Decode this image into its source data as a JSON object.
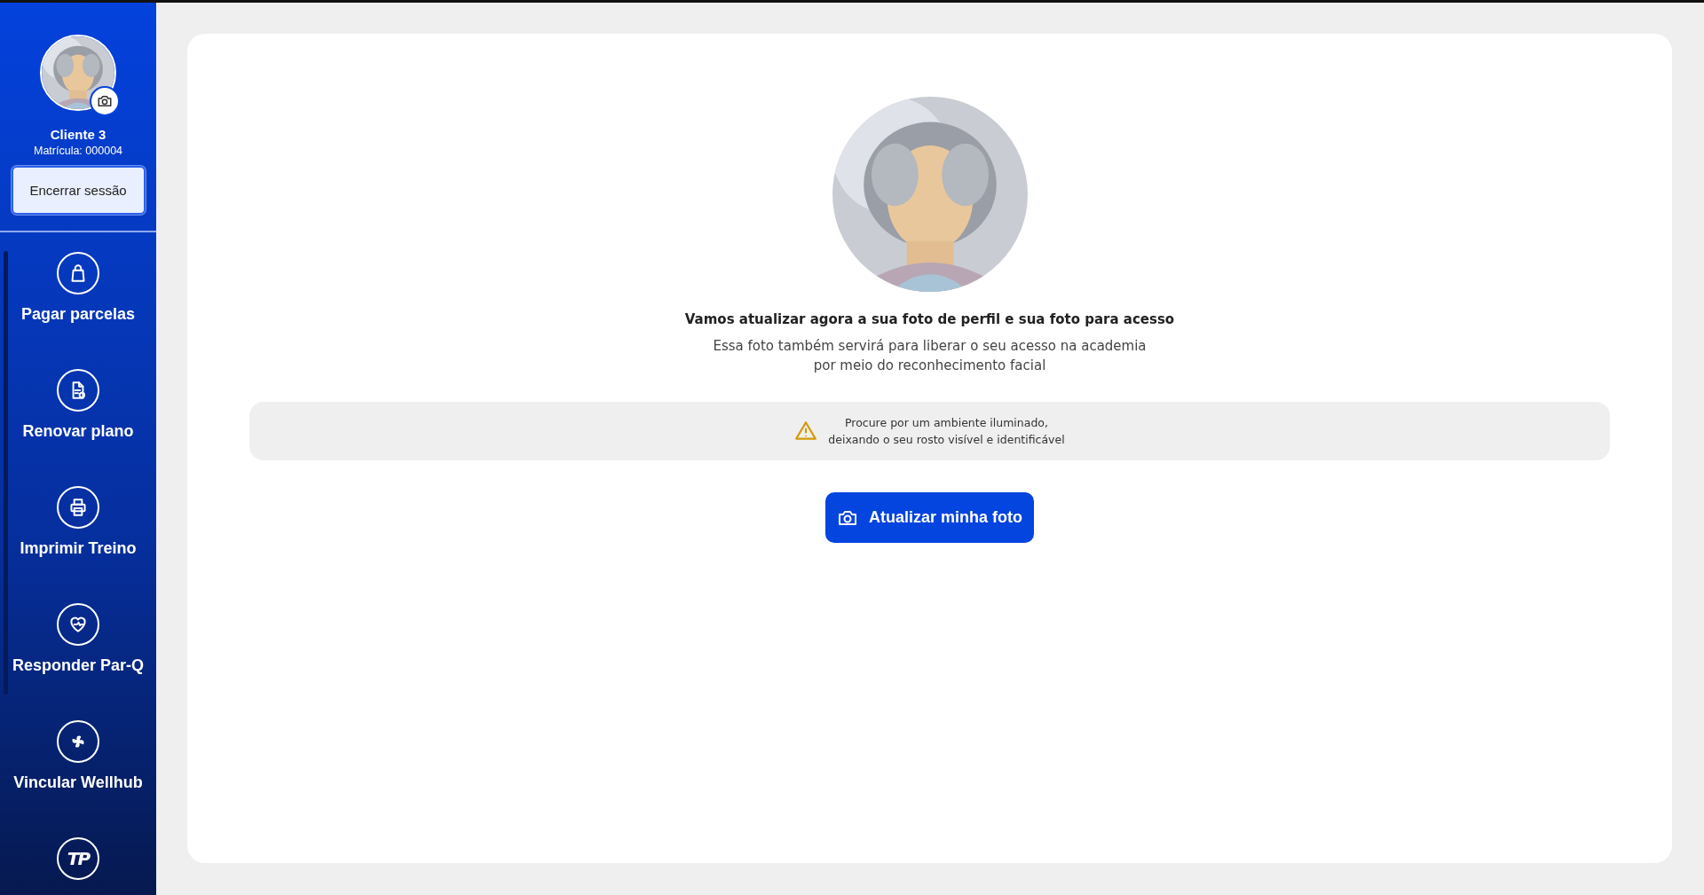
{
  "sidebar": {
    "user": {
      "name": "Cliente 3",
      "registration": "Matrícula: 000004"
    },
    "logout_button": "Encerrar sessão",
    "items": [
      {
        "label": "Pagar parcelas"
      },
      {
        "label": "Renovar plano"
      },
      {
        "label": "Imprimir Treino"
      },
      {
        "label": "Responder Par-Q"
      },
      {
        "label": "Vincular Wellhub"
      },
      {
        "logo_text": "TP"
      }
    ]
  },
  "main": {
    "heading": "Vamos atualizar agora a sua foto de perfil e sua foto para acesso",
    "description": [
      "Essa foto também servirá para liberar o seu acesso na academia",
      "por meio do reconhecimento facial"
    ],
    "tip": [
      "Procure por um ambiente iluminado,",
      "deixando o seu rosto visível e identificável"
    ],
    "button": "Atualizar minha foto"
  }
}
